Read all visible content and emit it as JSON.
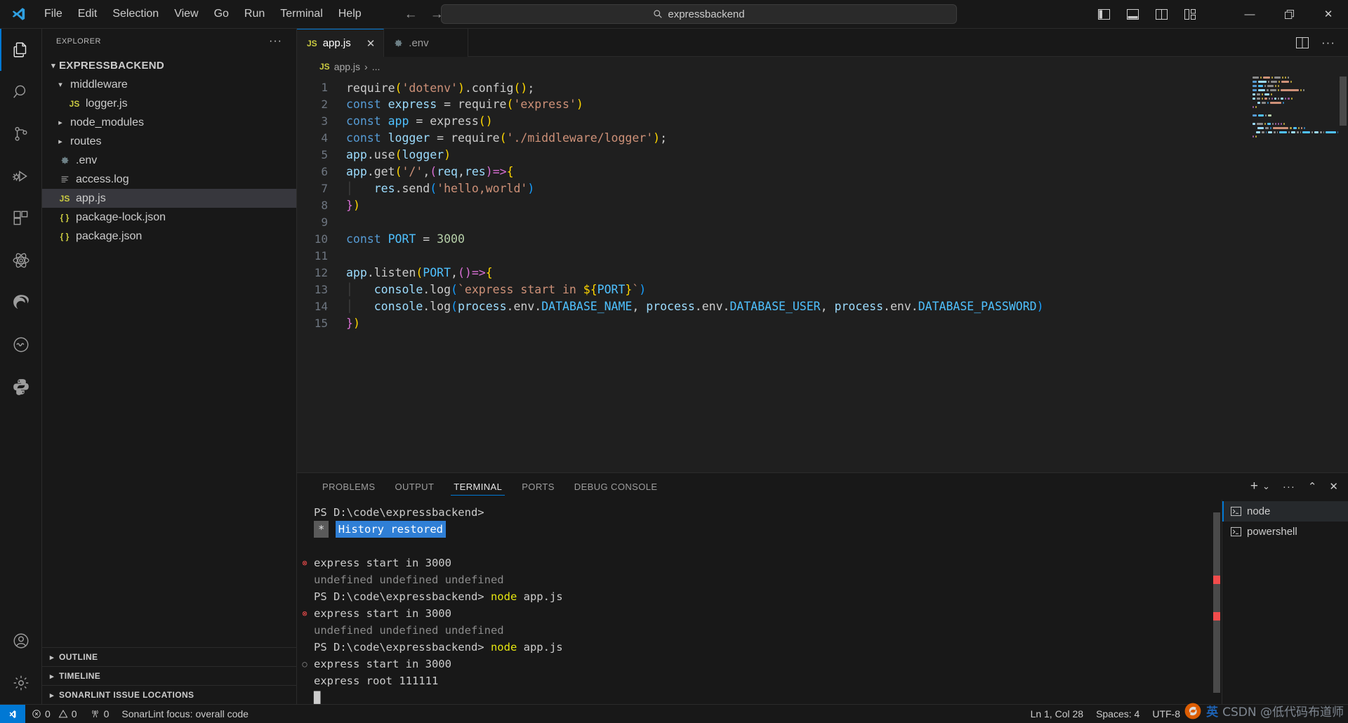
{
  "titlebar": {
    "menus": [
      "File",
      "Edit",
      "Selection",
      "View",
      "Go",
      "Run",
      "Terminal",
      "Help"
    ],
    "back_arrow": "←",
    "forward_arrow": "→",
    "search_value": "expressbackend",
    "layout_icons": [
      "toggle-primary-sidebar",
      "toggle-panel",
      "toggle-secondary-sidebar",
      "customize-layout"
    ],
    "window_controls": {
      "minimize": "—",
      "maximize": "❐",
      "close": "✕"
    }
  },
  "activitybar": {
    "items": [
      {
        "name": "explorer",
        "active": true
      },
      {
        "name": "search",
        "active": false
      },
      {
        "name": "source-control",
        "active": false
      },
      {
        "name": "run-and-debug",
        "active": false
      },
      {
        "name": "extensions",
        "active": false
      },
      {
        "name": "react-devtools",
        "active": false
      },
      {
        "name": "edge-tools",
        "active": false
      },
      {
        "name": "squiggle-tool",
        "active": false
      },
      {
        "name": "python",
        "active": false
      }
    ],
    "bottom": [
      {
        "name": "accounts"
      },
      {
        "name": "manage-settings"
      }
    ]
  },
  "sidebar": {
    "title": "EXPLORER",
    "more_actions": "···",
    "root": {
      "label": "EXPRESSBACKEND",
      "expanded": true
    },
    "tree": [
      {
        "label": "middleware",
        "type": "folder",
        "expanded": true,
        "depth": 1,
        "icon": "chevron-down-icon"
      },
      {
        "label": "logger.js",
        "type": "js",
        "depth": 2,
        "icon": "js-file-icon"
      },
      {
        "label": "node_modules",
        "type": "folder",
        "expanded": false,
        "depth": 1,
        "icon": "chevron-right-icon"
      },
      {
        "label": "routes",
        "type": "folder",
        "expanded": false,
        "depth": 1,
        "icon": "chevron-right-icon"
      },
      {
        "label": ".env",
        "type": "env",
        "depth": 1,
        "icon": "gear-file-icon"
      },
      {
        "label": "access.log",
        "type": "log",
        "depth": 1,
        "icon": "log-file-icon"
      },
      {
        "label": "app.js",
        "type": "js",
        "depth": 1,
        "icon": "js-file-icon",
        "selected": true
      },
      {
        "label": "package-lock.json",
        "type": "json",
        "depth": 1,
        "icon": "json-file-icon"
      },
      {
        "label": "package.json",
        "type": "json",
        "depth": 1,
        "icon": "json-file-icon"
      }
    ],
    "sections": [
      {
        "label": "OUTLINE",
        "expanded": false
      },
      {
        "label": "TIMELINE",
        "expanded": false
      },
      {
        "label": "SONARLINT ISSUE LOCATIONS",
        "expanded": false
      }
    ]
  },
  "editor": {
    "tabs": [
      {
        "label": "app.js",
        "icon": "js-file-icon",
        "active": true,
        "close": "✕"
      },
      {
        "label": ".env",
        "icon": "gear-file-icon",
        "active": false
      }
    ],
    "actions": {
      "split_editor": "split-editor-icon",
      "more": "···"
    },
    "breadcrumb": {
      "file": "app.js",
      "separator": "›",
      "rest": "..."
    },
    "line_numbers": [
      1,
      2,
      3,
      4,
      5,
      6,
      7,
      8,
      9,
      10,
      11,
      12,
      13,
      14,
      15
    ],
    "code_lines": [
      [
        {
          "t": "require",
          "c": "pun"
        },
        {
          "t": "(",
          "c": "par1"
        },
        {
          "t": "'dotenv'",
          "c": "str"
        },
        {
          "t": ")",
          "c": "par1"
        },
        {
          "t": ".config",
          "c": "pun"
        },
        {
          "t": "(",
          "c": "par1"
        },
        {
          "t": ")",
          "c": "par1"
        },
        {
          "t": ";",
          "c": "pun"
        }
      ],
      [
        {
          "t": "const",
          "c": "kw"
        },
        {
          "t": " express ",
          "c": "var"
        },
        {
          "t": "= ",
          "c": "pun"
        },
        {
          "t": "require",
          "c": "pun"
        },
        {
          "t": "(",
          "c": "par1"
        },
        {
          "t": "'express'",
          "c": "str"
        },
        {
          "t": ")",
          "c": "par1"
        }
      ],
      [
        {
          "t": "const",
          "c": "kw"
        },
        {
          "t": " app ",
          "c": "cst"
        },
        {
          "t": "= ",
          "c": "pun"
        },
        {
          "t": "express",
          "c": "pun"
        },
        {
          "t": "(",
          "c": "par1"
        },
        {
          "t": ")",
          "c": "par1"
        }
      ],
      [
        {
          "t": "const",
          "c": "kw"
        },
        {
          "t": " logger ",
          "c": "var"
        },
        {
          "t": "= ",
          "c": "pun"
        },
        {
          "t": "require",
          "c": "pun"
        },
        {
          "t": "(",
          "c": "par1"
        },
        {
          "t": "'./middleware/logger'",
          "c": "str"
        },
        {
          "t": ")",
          "c": "par1"
        },
        {
          "t": ";",
          "c": "pun"
        }
      ],
      [
        {
          "t": "app",
          "c": "var"
        },
        {
          "t": ".use",
          "c": "pun"
        },
        {
          "t": "(",
          "c": "par1"
        },
        {
          "t": "logger",
          "c": "var"
        },
        {
          "t": ")",
          "c": "par1"
        }
      ],
      [
        {
          "t": "app",
          "c": "var"
        },
        {
          "t": ".get",
          "c": "pun"
        },
        {
          "t": "(",
          "c": "par1"
        },
        {
          "t": "'/'",
          "c": "str"
        },
        {
          "t": ",",
          "c": "pun"
        },
        {
          "t": "(",
          "c": "par2"
        },
        {
          "t": "req",
          "c": "var"
        },
        {
          "t": ",",
          "c": "pun"
        },
        {
          "t": "res",
          "c": "var"
        },
        {
          "t": ")",
          "c": "par2"
        },
        {
          "t": "=>",
          "c": "par2"
        },
        {
          "t": "{",
          "c": "par1"
        }
      ],
      [
        {
          "t": "    ",
          "c": "indent-guide"
        },
        {
          "t": "res",
          "c": "var"
        },
        {
          "t": ".send",
          "c": "pun"
        },
        {
          "t": "(",
          "c": "par3"
        },
        {
          "t": "'hello,world'",
          "c": "str"
        },
        {
          "t": ")",
          "c": "par3"
        }
      ],
      [
        {
          "t": "}",
          "c": "par2"
        },
        {
          "t": ")",
          "c": "par1"
        }
      ],
      [],
      [
        {
          "t": "const",
          "c": "kw"
        },
        {
          "t": " PORT ",
          "c": "cst"
        },
        {
          "t": "= ",
          "c": "pun"
        },
        {
          "t": "3000",
          "c": "num"
        }
      ],
      [],
      [
        {
          "t": "app",
          "c": "var"
        },
        {
          "t": ".listen",
          "c": "pun"
        },
        {
          "t": "(",
          "c": "par1"
        },
        {
          "t": "PORT",
          "c": "cst"
        },
        {
          "t": ",",
          "c": "pun"
        },
        {
          "t": "(",
          "c": "par2"
        },
        {
          "t": ")",
          "c": "par2"
        },
        {
          "t": "=>",
          "c": "par2"
        },
        {
          "t": "{",
          "c": "par1"
        }
      ],
      [
        {
          "t": "    ",
          "c": "indent-guide"
        },
        {
          "t": "console",
          "c": "var"
        },
        {
          "t": ".log",
          "c": "pun"
        },
        {
          "t": "(",
          "c": "par3"
        },
        {
          "t": "`express start in ",
          "c": "tpl"
        },
        {
          "t": "${",
          "c": "par1"
        },
        {
          "t": "PORT",
          "c": "cst"
        },
        {
          "t": "}",
          "c": "par1"
        },
        {
          "t": "`",
          "c": "tpl"
        },
        {
          "t": ")",
          "c": "par3"
        }
      ],
      [
        {
          "t": "    ",
          "c": "indent-guide"
        },
        {
          "t": "console",
          "c": "var"
        },
        {
          "t": ".log",
          "c": "pun"
        },
        {
          "t": "(",
          "c": "par3"
        },
        {
          "t": "process",
          "c": "var"
        },
        {
          "t": ".env",
          "c": "pun"
        },
        {
          "t": ".",
          "c": "pun"
        },
        {
          "t": "DATABASE_NAME",
          "c": "cst"
        },
        {
          "t": ", ",
          "c": "pun"
        },
        {
          "t": "process",
          "c": "var"
        },
        {
          "t": ".env",
          "c": "pun"
        },
        {
          "t": ".",
          "c": "pun"
        },
        {
          "t": "DATABASE_USER",
          "c": "cst"
        },
        {
          "t": ", ",
          "c": "pun"
        },
        {
          "t": "process",
          "c": "var"
        },
        {
          "t": ".env",
          "c": "pun"
        },
        {
          "t": ".",
          "c": "pun"
        },
        {
          "t": "DATABASE_PASSWORD",
          "c": "cst"
        },
        {
          "t": ")",
          "c": "par3"
        }
      ],
      [
        {
          "t": "}",
          "c": "par2"
        },
        {
          "t": ")",
          "c": "par1"
        }
      ]
    ]
  },
  "panel": {
    "tabs": [
      {
        "label": "PROBLEMS",
        "active": false
      },
      {
        "label": "OUTPUT",
        "active": false
      },
      {
        "label": "TERMINAL",
        "active": true
      },
      {
        "label": "PORTS",
        "active": false
      },
      {
        "label": "DEBUG CONSOLE",
        "active": false
      }
    ],
    "actions": {
      "new_terminal": "+",
      "new_terminal_dropdown": "⌄",
      "views_and_more": "···",
      "maximize": "⌃",
      "close": "✕"
    },
    "terminal_lines": [
      {
        "marker": "",
        "segments": [
          {
            "t": "PS D:\\code\\expressbackend>",
            "c": ""
          }
        ]
      },
      {
        "marker": "",
        "segments": [
          {
            "t": "*",
            "c": "hl-gray"
          },
          {
            "t": " ",
            "c": ""
          },
          {
            "t": "History restored",
            "c": "hl-blue"
          }
        ]
      },
      {
        "marker": "",
        "segments": []
      },
      {
        "marker": "err",
        "segments": [
          {
            "t": "express start in 3000",
            "c": ""
          }
        ]
      },
      {
        "marker": "",
        "segments": [
          {
            "t": "undefined undefined undefined",
            "c": "t-dim"
          }
        ]
      },
      {
        "marker": "",
        "segments": [
          {
            "t": "PS D:\\code\\expressbackend> ",
            "c": ""
          },
          {
            "t": "node",
            "c": "t-yellow"
          },
          {
            "t": " app.js",
            "c": ""
          }
        ]
      },
      {
        "marker": "err",
        "segments": [
          {
            "t": "express start in 3000",
            "c": ""
          }
        ]
      },
      {
        "marker": "",
        "segments": [
          {
            "t": "undefined undefined undefined",
            "c": "t-dim"
          }
        ]
      },
      {
        "marker": "",
        "segments": [
          {
            "t": "PS D:\\code\\expressbackend> ",
            "c": ""
          },
          {
            "t": "node",
            "c": "t-yellow"
          },
          {
            "t": " app.js",
            "c": ""
          }
        ]
      },
      {
        "marker": "ok",
        "segments": [
          {
            "t": "express start in 3000",
            "c": ""
          }
        ]
      },
      {
        "marker": "",
        "segments": [
          {
            "t": "express root 111111",
            "c": ""
          }
        ]
      },
      {
        "marker": "",
        "segments": [
          {
            "t": "█",
            "c": ""
          }
        ]
      }
    ],
    "terminal_list": [
      {
        "label": "node",
        "icon": "terminal-icon",
        "active": true
      },
      {
        "label": "powershell",
        "icon": "terminal-icon",
        "active": false
      }
    ]
  },
  "statusbar": {
    "remote_icon": "remote-window-icon",
    "errors": "0",
    "warnings": "0",
    "ports": "0",
    "sonarlint": "SonarLint focus: overall code",
    "cursor": "Ln 1, Col 28",
    "spaces": "Spaces: 4",
    "encoding": "UTF-8",
    "watermark": "CSDN @低代码布道师",
    "watermark_lang": "英"
  },
  "colors": {
    "accent": "#0078d4",
    "error": "#f14c4c",
    "bg": "#1f1f1f",
    "chrome": "#181818",
    "selection": "#37373d"
  }
}
